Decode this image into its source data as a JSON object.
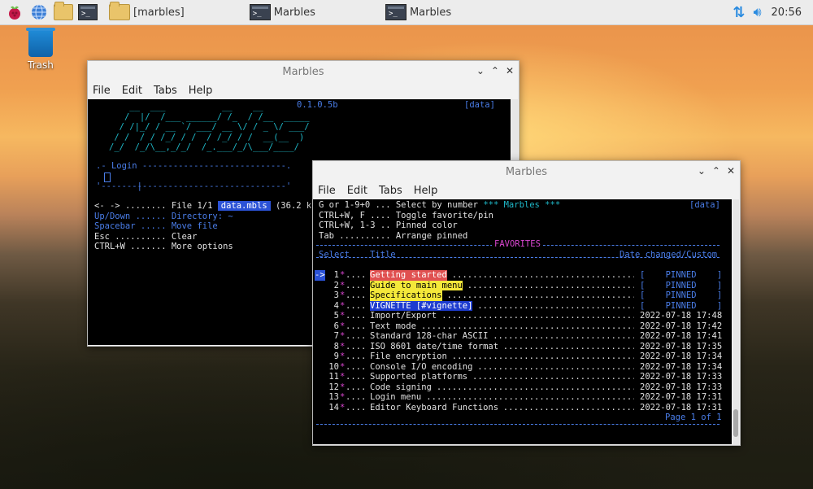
{
  "taskbar": {
    "folder_task": "[marbles]",
    "terminal_task_1": "Marbles",
    "terminal_task_2": "Marbles",
    "clock": "20:56"
  },
  "desktop": {
    "trash_label": "Trash"
  },
  "window1": {
    "title": "Marbles",
    "menu": [
      "File",
      "Edit",
      "Tabs",
      "Help"
    ],
    "version": "0.1.0.5b",
    "data_tag": "[data]",
    "logo_lines": [
      "    __  ___           __    __",
      "   /  |/  /___ ______/ /_  / /__  _____",
      "  / /|_/ / __ `/ ___/ __ \\/ / _ \\/ ___/",
      " / /  / / /_/ / /  / /_/ / /  __(__  )",
      "/_/  /_/\\__,_/_/  /_.___/_/\\___/____/"
    ],
    "login_box_top": ".- Login ----------------------------.",
    "login_box_mid": "|                                    |",
    "login_box_bot": "'------------------------------------'",
    "keys": [
      {
        "key": "<- ->",
        "dots": "........",
        "desc": "File 1/1",
        "extra": "data.mbls",
        "tail": "(36.2 k"
      },
      {
        "key": "Up/Down",
        "dots": "......",
        "desc": "Directory: ~"
      },
      {
        "key": "Spacebar",
        "dots": ".....",
        "desc": "Move file"
      },
      {
        "key": "Esc",
        "dots": "..........",
        "desc": "Clear"
      },
      {
        "key": "CTRL+W",
        "dots": ".......",
        "desc": "More options"
      }
    ]
  },
  "window2": {
    "title": "Marbles",
    "menu": [
      "File",
      "Edit",
      "Tabs",
      "Help"
    ],
    "help_lines": [
      {
        "key": "G or 1-9+0",
        "dots": "...",
        "desc": "Select by number",
        "extra": "*** Marbles ***"
      },
      {
        "key": "CTRL+W, F",
        "dots": "....",
        "desc": "Toggle favorite/pin"
      },
      {
        "key": "CTRL+W, 1-3",
        "dots": "..",
        "desc": "Pinned color"
      },
      {
        "key": "Tab",
        "dots": "..........",
        "desc": "Arrange pinned"
      }
    ],
    "data_tag": "[data]",
    "favorites_label": "FAVORITES",
    "col_select": "Select",
    "col_title": "Title",
    "col_date": "Date changed/Custom",
    "rows": [
      {
        "num": "1",
        "title": "Getting started",
        "date": "[    PINNED    ]",
        "hl": "red",
        "selected": true
      },
      {
        "num": "2",
        "title": "Guide to main menu",
        "date": "[    PINNED    ]",
        "hl": "yel"
      },
      {
        "num": "3",
        "title": "Specifications",
        "date": "[    PINNED    ]",
        "hl": "yel"
      },
      {
        "num": "4",
        "title": "VIGNETTE [#vignette]",
        "date": "[    PINNED    ]",
        "hl": "blue"
      },
      {
        "num": "5",
        "title": "Import/Export",
        "date": "2022-07-18 17:48"
      },
      {
        "num": "6",
        "title": "Text mode",
        "date": "2022-07-18 17:42"
      },
      {
        "num": "7",
        "title": "Standard 128-char ASCII",
        "date": "2022-07-18 17:41"
      },
      {
        "num": "8",
        "title": "ISO 8601 date/time format",
        "date": "2022-07-18 17:35"
      },
      {
        "num": "9",
        "title": "File encryption",
        "date": "2022-07-18 17:34"
      },
      {
        "num": "10",
        "title": "Console I/O encoding",
        "date": "2022-07-18 17:34"
      },
      {
        "num": "11",
        "title": "Supported platforms",
        "date": "2022-07-18 17:33"
      },
      {
        "num": "12",
        "title": "Code signing",
        "date": "2022-07-18 17:33"
      },
      {
        "num": "13",
        "title": "Login menu",
        "date": "2022-07-18 17:31"
      },
      {
        "num": "14",
        "title": "Editor Keyboard Functions",
        "date": "2022-07-18 17:31"
      }
    ],
    "page_label": "Page 1 of 1"
  },
  "colors": {
    "accent_cyan": "#1fb9c9",
    "accent_blue": "#4a7de8",
    "accent_magenta": "#d946d0"
  }
}
